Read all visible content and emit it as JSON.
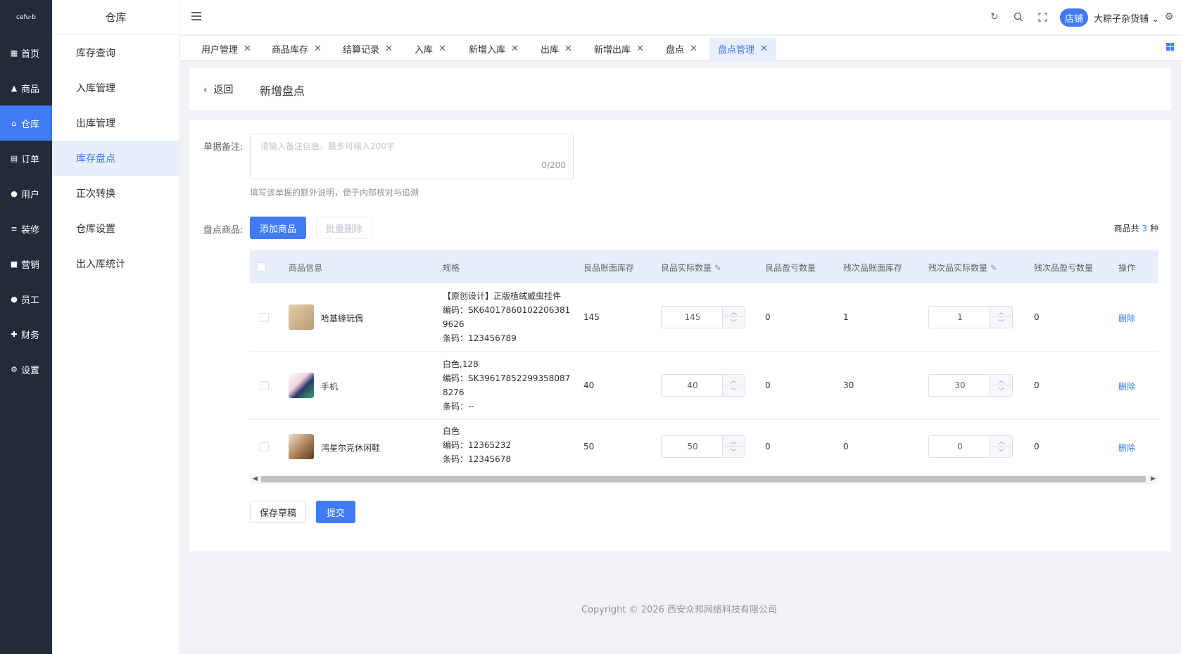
{
  "logo": "cefu·b",
  "nav": [
    {
      "label": "首页",
      "icon": "grid-icon"
    },
    {
      "label": "商品",
      "icon": "bag-icon"
    },
    {
      "label": "仓库",
      "icon": "warehouse-icon"
    },
    {
      "label": "订单",
      "icon": "clipboard-icon"
    },
    {
      "label": "用户",
      "icon": "user-icon"
    },
    {
      "label": "装修",
      "icon": "sliders-icon"
    },
    {
      "label": "营销",
      "icon": "message-icon"
    },
    {
      "label": "员工",
      "icon": "staff-icon"
    },
    {
      "label": "财务",
      "icon": "finance-icon"
    },
    {
      "label": "设置",
      "icon": "gear-icon"
    }
  ],
  "subnav": {
    "title": "仓库",
    "items": [
      "库存查询",
      "入库管理",
      "出库管理",
      "库存盘点",
      "正次转换",
      "仓库设置",
      "出入库统计"
    ]
  },
  "header": {
    "shop_badge": "店铺",
    "shop_name": "大粽子杂货铺 ⌄"
  },
  "tabs": [
    "用户管理",
    "商品库存",
    "结算记录",
    "入库",
    "新增入库",
    "出库",
    "新增出库",
    "盘点",
    "盘点管理"
  ],
  "page": {
    "back": "返回",
    "title": "新增盘点"
  },
  "form": {
    "remark_label": "单据备注:",
    "remark_placeholder": "请输入备注信息，最多可输入200字",
    "remark_count": "0/200",
    "remark_hint": "填写该单据的额外说明，便于内部核对与追溯",
    "goods_label": "盘点商品:",
    "add_button": "添加商品",
    "batch_delete_button": "批量删除",
    "total_prefix": "商品共",
    "total_num": "3",
    "total_suffix": "种"
  },
  "table": {
    "headers": [
      "商品信息",
      "规格",
      "良品账面库存",
      "良品实际数量",
      "良品盈亏数量",
      "残次品账面库存",
      "残次品实际数量",
      "残次品盈亏数量",
      "操作"
    ],
    "rows": [
      {
        "name": "哈基蜂玩偶",
        "spec": "【原创设计】正版植绒威虫挂件",
        "code": "编码：SK640178601022063819626",
        "barcode": "条码：123456789",
        "good_book": "145",
        "good_actual": "145",
        "good_diff": "0",
        "bad_book": "1",
        "bad_actual": "1",
        "bad_diff": "0",
        "action": "删除"
      },
      {
        "name": "手机",
        "spec": "白色,128",
        "code": "编码：SK396178522993580878276",
        "barcode": "条码：--",
        "good_book": "40",
        "good_actual": "40",
        "good_diff": "0",
        "bad_book": "30",
        "bad_actual": "30",
        "bad_diff": "0",
        "action": "删除"
      },
      {
        "name": "鸿星尔克休闲鞋",
        "spec": "白色",
        "code": "编码：12365232",
        "barcode": "条码：12345678",
        "good_book": "50",
        "good_actual": "50",
        "good_diff": "0",
        "bad_book": "0",
        "bad_actual": "0",
        "bad_diff": "0",
        "action": "删除"
      }
    ]
  },
  "actions": {
    "save_draft": "保存草稿",
    "submit": "提交"
  },
  "footer": "Copyright © 2026 西安众邦网络科技有限公司",
  "colors": {
    "primary": "#3f7bf5",
    "nav_dark": "#222b3a"
  }
}
